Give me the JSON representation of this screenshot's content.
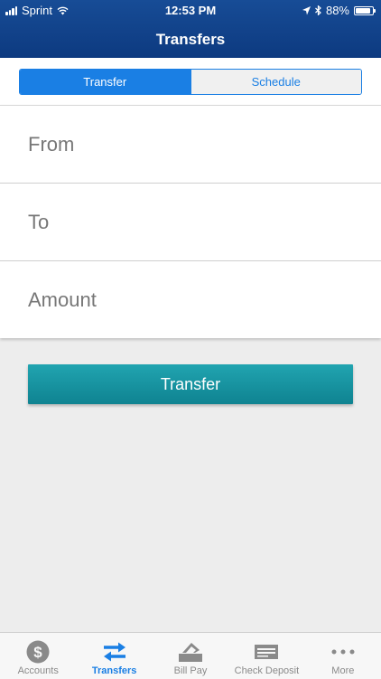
{
  "status_bar": {
    "carrier": "Sprint",
    "time": "12:53 PM",
    "battery_percent": "88%",
    "battery_level": 0.88
  },
  "header": {
    "title": "Transfers"
  },
  "segmented": {
    "options": [
      {
        "label": "Transfer",
        "selected": true
      },
      {
        "label": "Schedule",
        "selected": false
      }
    ]
  },
  "form": {
    "fields": [
      {
        "label": "From"
      },
      {
        "label": "To"
      },
      {
        "label": "Amount"
      }
    ]
  },
  "actions": {
    "transfer_label": "Transfer"
  },
  "tabbar": {
    "tabs": [
      {
        "label": "Accounts",
        "icon": "dollar-icon",
        "active": false
      },
      {
        "label": "Transfers",
        "icon": "transfer-arrows-icon",
        "active": true
      },
      {
        "label": "Bill Pay",
        "icon": "bill-pay-icon",
        "active": false
      },
      {
        "label": "Check Deposit",
        "icon": "check-deposit-icon",
        "active": false
      },
      {
        "label": "More",
        "icon": "more-icon",
        "active": false
      }
    ]
  },
  "colors": {
    "header": "#174c96",
    "accent": "#1a7fe4",
    "button": "#1599a6",
    "background": "#ededed"
  }
}
